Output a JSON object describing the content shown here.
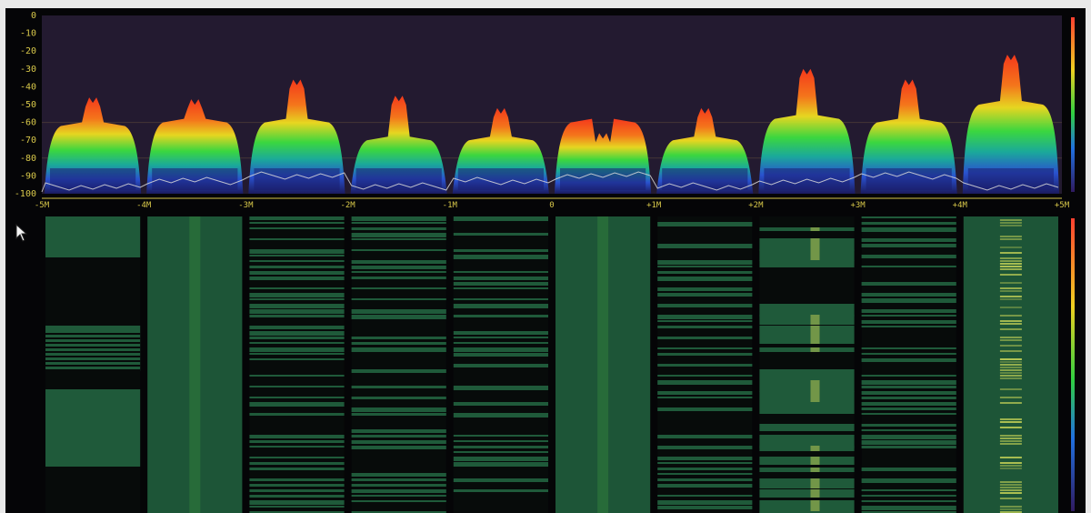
{
  "spectrum": {
    "y_ticks": [
      "0",
      "-10",
      "-20",
      "-30",
      "-40",
      "-50",
      "-60",
      "-70",
      "-80",
      "-90",
      "-100"
    ],
    "x_ticks": [
      "-5M",
      "-4M",
      "-3M",
      "-2M",
      "-1M",
      "0",
      "+1M",
      "+2M",
      "+3M",
      "+4M",
      "+5M"
    ],
    "y_range": [
      -100,
      0
    ],
    "x_range_mhz": [
      -5,
      5
    ]
  },
  "channels": [
    {
      "center_mhz": -4.5,
      "peak_db": -46,
      "plateau_db": -62,
      "occupancy": 0.45,
      "waterfall_pattern": "blocks"
    },
    {
      "center_mhz": -3.5,
      "peak_db": -47,
      "plateau_db": -60,
      "occupancy": 1.0,
      "waterfall_pattern": "continuous"
    },
    {
      "center_mhz": -2.5,
      "peak_db": -36,
      "plateau_db": -60,
      "occupancy": 0.7,
      "waterfall_pattern": "lines"
    },
    {
      "center_mhz": -1.5,
      "peak_db": -45,
      "plateau_db": -70,
      "occupancy": 0.55,
      "waterfall_pattern": "lines"
    },
    {
      "center_mhz": -0.5,
      "peak_db": -52,
      "plateau_db": -70,
      "occupancy": 0.5,
      "waterfall_pattern": "lines"
    },
    {
      "center_mhz": 0.5,
      "peak_db": -66,
      "plateau_db": -60,
      "occupancy": 1.0,
      "waterfall_pattern": "continuous"
    },
    {
      "center_mhz": 1.5,
      "peak_db": -52,
      "plateau_db": -70,
      "occupancy": 0.6,
      "waterfall_pattern": "lines"
    },
    {
      "center_mhz": 2.5,
      "peak_db": -30,
      "plateau_db": -58,
      "occupancy": 0.7,
      "waterfall_pattern": "bands"
    },
    {
      "center_mhz": 3.5,
      "peak_db": -36,
      "plateau_db": -60,
      "occupancy": 0.7,
      "waterfall_pattern": "lines"
    },
    {
      "center_mhz": 4.5,
      "peak_db": -22,
      "plateau_db": -50,
      "occupancy": 1.0,
      "waterfall_pattern": "continuous"
    }
  ],
  "colors": {
    "background": "#050507",
    "spectrum_bg": "#231a30",
    "axis_text": "#d8c84a",
    "gridline": "#5a4a3a",
    "waterfall_signal": "#1f5a3a",
    "waterfall_hot": "#d7e05a",
    "trace": "#d8d8d8"
  },
  "icons": {
    "cursor": "mouse-pointer-icon"
  }
}
